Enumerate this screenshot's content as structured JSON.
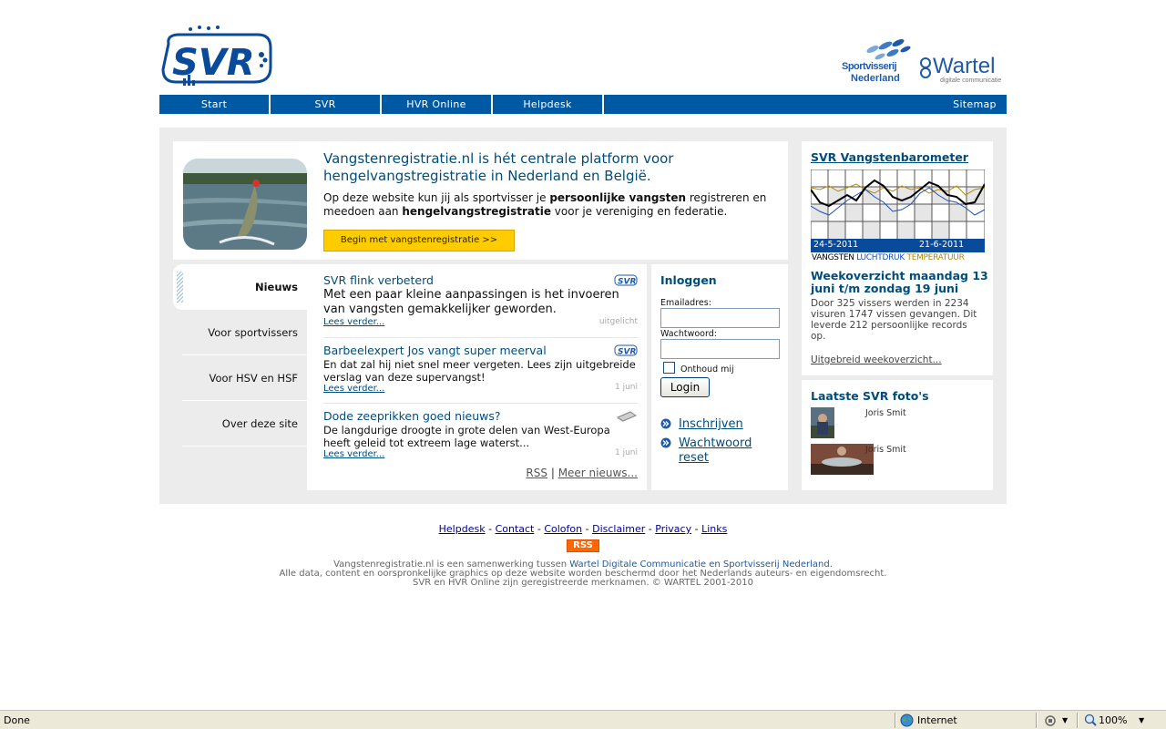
{
  "header": {
    "logo_text": "SVR",
    "partner_1": "Sportvisserij Nederland",
    "partner_2_name": "Wartel",
    "partner_2_tagline": "digitale communicatie"
  },
  "nav": {
    "items": [
      "Start",
      "SVR",
      "HVR Online",
      "Helpdesk"
    ],
    "sitemap": "Sitemap"
  },
  "intro": {
    "title": "Vangstenregistratie.nl is hét centrale platform voor hengelvangstregistratie in Nederland en België.",
    "text_1": "Op deze website kun jij als sportvisser je ",
    "text_bold_1": "persoonlijke vangsten",
    "text_2": " registreren en meedoen aan ",
    "text_bold_2": "hengelvangstregistratie",
    "text_3": " voor je vereniging en federatie.",
    "cta": "Begin met vangstenregistratie >>"
  },
  "tabs": [
    "Nieuws",
    "Voor sportvissers",
    "Voor HSV en HSF",
    "Over deze site"
  ],
  "news": {
    "items": [
      {
        "title": "SVR flink verbeterd",
        "body": "Met een paar kleine aanpassingen is het invoeren van vangsten gemakkelijker geworden.",
        "more": "Lees verder...",
        "meta": "uitgelicht"
      },
      {
        "title": "Barbeelexpert Jos vangt super meerval",
        "body": "En dat zal hij niet snel meer vergeten. Lees zijn uitgebreide verslag van deze supervangst!",
        "more": "Lees verder...",
        "meta": "1 juni"
      },
      {
        "title": "Dode zeeprikken goed nieuws?",
        "body": "De langdurige droogte in grote delen van West-Europa heeft geleid tot extreem lage waterst...",
        "more": "Lees verder...",
        "meta": "1 juni"
      }
    ],
    "rss": "RSS",
    "separator": "|",
    "more_news": "Meer nieuws..."
  },
  "login": {
    "title": "Inloggen",
    "email_label": "Emailadres:",
    "email_value": "",
    "password_label": "Wachtwoord:",
    "password_value": "",
    "remember": "Onthoud mij",
    "button": "Login",
    "register": "Inschrijven",
    "reset": "Wachtwoord reset"
  },
  "barometer": {
    "title": "SVR Vangstenbarometer",
    "date_start": "24-5-2011",
    "date_end": "21-6-2011",
    "legend": [
      "VANGSTEN",
      "LUCHTDRUK",
      "TEMPERATUUR"
    ],
    "legend_colors": [
      "#000000",
      "#1e4fb5",
      "#b08a00"
    ],
    "week_title": "Weekoverzicht maandag 13 juni t/m zondag 19 juni",
    "week_text": "Door 325 vissers werden in 2234 visuren 1747 vissen gevangen. Dit leverde 212 persoonlijke records op.",
    "week_link": "Uitgebreid weekoverzicht..."
  },
  "photos": {
    "title": "Laatste SVR foto's",
    "items": [
      {
        "caption": "Joris Smit"
      },
      {
        "caption": "Joris Smit"
      }
    ]
  },
  "footer": {
    "links": [
      "Helpdesk",
      "Contact",
      "Colofon",
      "Disclaimer",
      "Privacy",
      "Links"
    ],
    "link_separator": "-",
    "rss": "RSS",
    "line1_a": "Vangstenregistratie.nl is een samenwerking tussen ",
    "line1_b": "Wartel Digitale Communicatie en Sportvisserij Nederland.",
    "line2": "Alle data, content en oorspronkelijke graphics op deze website worden beschermd door het Nederlands auteurs- en eigendomsrecht.",
    "line3": "SVR en HVR Online zijn geregistreerde merknamen. © WARTEL 2001-2010"
  },
  "statusbar": {
    "status": "Done",
    "zone": "Internet",
    "zoom": "100%"
  },
  "colors": {
    "nav": "#005aa3",
    "accent": "#004d7a",
    "cta": "#ffcc00",
    "panel": "#ececec"
  }
}
